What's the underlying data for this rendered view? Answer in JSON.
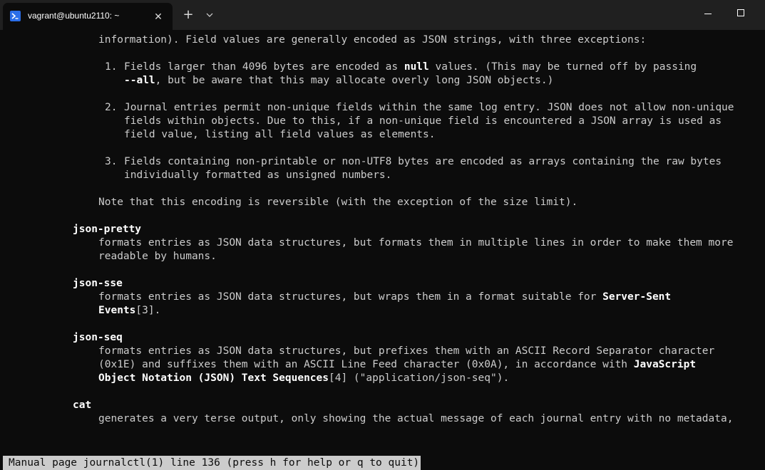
{
  "window": {
    "tab_title": "vagrant@ubuntu2110: ~",
    "tab_close": "✕",
    "new_tab": "+",
    "minimize_icon": "minimize-icon",
    "maximize_icon": "maximize-icon"
  },
  "terminal": {
    "l01": "information). Field values are generally encoded as JSON strings, with three exceptions:",
    "l02_num": "1.",
    "l02a": "Fields larger than 4096 bytes are encoded as ",
    "l02b": "null",
    "l02c": " values. (This may be turned off by passing",
    "l03a": "--all",
    "l03b": ", but be aware that this may allocate overly long JSON objects.)",
    "l04_num": "2.",
    "l04": "Journal entries permit non-unique fields within the same log entry. JSON does not allow non-unique",
    "l05": "fields within objects. Due to this, if a non-unique field is encountered a JSON array is used as",
    "l06": "field value, listing all field values as elements.",
    "l07_num": "3.",
    "l07": "Fields containing non-printable or non-UTF8 bytes are encoded as arrays containing the raw bytes",
    "l08": "individually formatted as unsigned numbers.",
    "l09": "Note that this encoding is reversible (with the exception of the size limit).",
    "h1": "json-pretty",
    "l10": "formats entries as JSON data structures, but formats them in multiple lines in order to make them more",
    "l11": "readable by humans.",
    "h2": "json-sse",
    "l12a": "formats entries as JSON data structures, but wraps them in a format suitable for ",
    "l12b": "Server-Sent",
    "l13a": "Events",
    "l13b": "[3].",
    "h3": "json-seq",
    "l14": "formats entries as JSON data structures, but prefixes them with an ASCII Record Separator character",
    "l15a": "(0x1E) and suffixes them with an ASCII Line Feed character (0x0A), in accordance with ",
    "l15b": "JavaScript",
    "l16a": "Object Notation (JSON) Text Sequences",
    "l16b": "[4] (\"application/json-seq\").",
    "h4": "cat",
    "l17": "generates a very terse output, only showing the actual message of each journal entry with no metadata,",
    "status": "Manual page journalctl(1) line 136 (press h for help or q to quit)"
  }
}
